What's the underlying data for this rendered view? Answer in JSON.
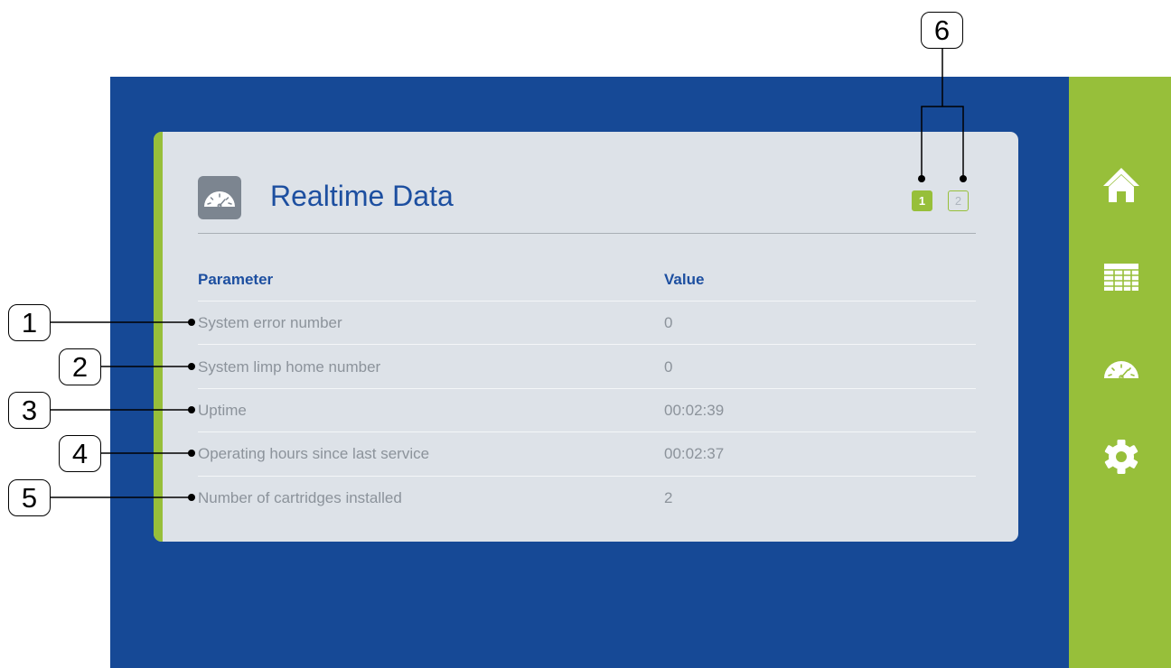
{
  "sidebar": {
    "items": [
      {
        "icon": "home-icon",
        "label": "Home"
      },
      {
        "icon": "table-icon",
        "label": "Table"
      },
      {
        "icon": "gauge-icon",
        "label": "Realtime data"
      },
      {
        "icon": "gear-icon",
        "label": "Settings"
      }
    ]
  },
  "panel": {
    "title": "Realtime Data",
    "title_icon": "gauge-icon",
    "pages": [
      "1",
      "2"
    ],
    "active_page": "1"
  },
  "table": {
    "headers": [
      "Parameter",
      "Value"
    ],
    "rows": [
      {
        "parameter": "System error number",
        "value": "0"
      },
      {
        "parameter": "System limp home number",
        "value": "0"
      },
      {
        "parameter": "Uptime",
        "value": "00:02:39"
      },
      {
        "parameter": "Operating hours since last service",
        "value": "00:02:37"
      },
      {
        "parameter": "Number of cartridges installed",
        "value": "2"
      }
    ]
  },
  "callouts": [
    "1",
    "2",
    "3",
    "4",
    "5",
    "6"
  ],
  "colors": {
    "background": "#164996",
    "sidebar": "#97bf3a",
    "panel": "#dde2e8",
    "title": "#1d4fa0",
    "row_text": "#8c939b"
  }
}
